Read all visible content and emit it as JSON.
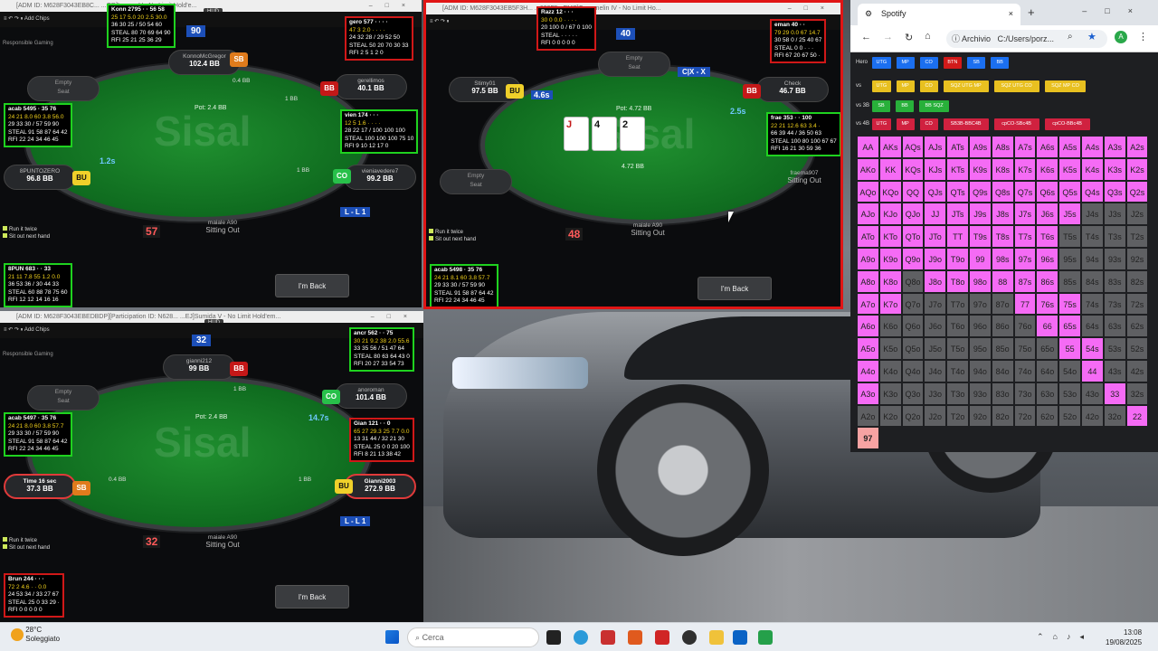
{
  "tables": [
    {
      "title": "[ADM ID: M628F3043EB8C... ...OD]Lumen V - No Limit Hold'e...",
      "hud_tag": "HUD",
      "toolbar_item": "Add Chips",
      "responsible": "Responsible Gaming",
      "pot": "Pot: 2.4 BB",
      "bet_top": "0.4 BB",
      "bet_right": "1 BB",
      "bet_bottom": "1 BB",
      "timer_left": "1.2s",
      "center_number": "57",
      "top_number": "90",
      "lbox": "L - L 1",
      "seats": {
        "top": {
          "name": "KonnoMcGregor",
          "stack": "102.4 BB"
        },
        "right_top": {
          "name": "gerellimos",
          "stack": "40.1 BB"
        },
        "left_top": {
          "name": "Empty",
          "stack": "Seat"
        },
        "left_bottom": {
          "name": "8PUNTOZERO",
          "stack": "96.8 BB"
        },
        "right_bottom": {
          "name": "vieniavedere7",
          "stack": "99.2 BB"
        },
        "bottom": {
          "name": "maiale A90",
          "status": "Sitting Out"
        }
      },
      "huds": {
        "a": [
          "Konn 2795 · · 56 58",
          "25 17 5.0 20 2.5 30.0",
          "36 30 25 / 50 54 60",
          "STEAL 80 70 69 64 90",
          "RFI 25 21 25 36 29"
        ],
        "b": [
          "gero 577 · · · ·",
          "47 3 2.0 · · · ·",
          "24 32 28 / 29 52 50",
          "STEAL 50 20 70 30 33",
          "RFI 2 5 1 2 0"
        ],
        "c": [
          "acab 5495 · 35 76",
          "24 21 8.0 60 3.8 56.0",
          "29 33 30 / 57 59 90",
          "STEAL 91 58 87 64 42",
          "RFI 22 24 34 46 45"
        ],
        "d": [
          "vien 174 · · ·",
          "12 5 1.6 · · · ·",
          "28 22 17 / 100 100 100",
          "STEAL 100 100 100 75 10",
          "RFI 9 10 12 17 0"
        ],
        "e": [
          "8PUN 683 · · 33",
          "21 11 7.8 55 1.2 0.0",
          "36 53 36 / 30 44 33",
          "STEAL 60 88 78 75 60",
          "RFI 12 12 14 16 16"
        ]
      },
      "run_it_twice": "Run it twice",
      "sit_out_next": "Sit out next hand",
      "button": "I'm Back"
    },
    {
      "title": "[ADM ID: M628F3043EB5F3H... ...628F5...EMS]Crommelin IV - No Limit Ho...",
      "pot": "Pot: 4.72 BB",
      "pot_chip": "4.72 BB",
      "cards": [
        "J",
        "4",
        "2"
      ],
      "center_number": "48",
      "top_number": "40",
      "timer_left": "4.6s",
      "timer_right": "2.5s",
      "action": "C|X - X",
      "seats": {
        "top": {
          "name": "Empty",
          "stack": "Seat"
        },
        "left_top": {
          "name": "Stimy01",
          "stack": "97.5 BB"
        },
        "right_top": {
          "name": "Check",
          "stack": "46.7 BB"
        },
        "left_bottom": {
          "name": "Empty",
          "stack": "Seat"
        },
        "right_bottom": {
          "name": "fraema907",
          "status": "Sitting Out"
        },
        "bottom": {
          "name": "maiale A90",
          "status": "Sitting Out"
        }
      },
      "huds": {
        "a": [
          "Razz 12 · · ·",
          "30 0 0.0 · · · ·",
          "20 100 0 / 67 0 100",
          "STEAL · · · · ·",
          "RFI 0 0 0 0 0"
        ],
        "b": [
          "eman 40 · ·",
          "79 29 0.0 67 14.7",
          "30 58 0 / 25 40 67",
          "STEAL 0 0 · · ·",
          "RFI 67 20 67 50 ·"
        ],
        "c": [
          "frae 353 · · 100",
          "22 21 12.6 63 3.4 ·",
          "66 39 44 / 36 50 63",
          "STEAL 100 80 100 67 67",
          "RFI 16 21 30 59 36"
        ],
        "d": [
          "acab 5498 · 35 76",
          "24 21 8.1 60 3.8 57.7",
          "29 33 30 / 57 59 90",
          "STEAL 91 58 87 64 42",
          "RFI 22 24 34 46 45"
        ]
      },
      "run_it_twice": "Run it twice",
      "sit_out_next": "Sit out next hand",
      "button": "I'm Back"
    },
    {
      "title": "[ADM ID: M628F3043EBEDBDP][Participation ID: N628... ...EJ]Sumida V - No Limit Hold'em...",
      "hud_tag": "HUD",
      "toolbar_item": "Add Chips",
      "responsible": "Responsible Gaming",
      "pot": "Pot: 2.4 BB",
      "bet_top": "1 BB",
      "bet_right": "1 BB",
      "bet_left": "0.4 BB",
      "timer_right": "14.7s",
      "center_number": "32",
      "top_number": "32",
      "lbox": "L - L 1",
      "seats": {
        "top": {
          "name": "gianni212",
          "stack": "99 BB"
        },
        "left_top": {
          "name": "Empty",
          "stack": "Seat"
        },
        "right_top": {
          "name": "anoroman",
          "stack": "101.4 BB"
        },
        "left_bottom": {
          "name": "Time 16 sec",
          "stack": "37.3 BB"
        },
        "right_bottom": {
          "name": "Gianni2003",
          "stack": "272.9 BB"
        },
        "bottom": {
          "name": "maiale A90",
          "status": "Sitting Out"
        }
      },
      "huds": {
        "a": [
          "ancr 562 · · 75",
          "30 21 9.2 38 2.0 55.6",
          "33 35 56 / 51 47 64",
          "STEAL 80 63 64 43 0",
          "RFI 20 27 33 54 73"
        ],
        "b": [
          "acab 5497 · 35 76",
          "24 21 8.0 60 3.8 57.7",
          "29 33 30 / 57 59 90",
          "STEAL 91 58 87 64 42",
          "RFI 22 24 34 46 45"
        ],
        "c": [
          "Gian 121 · · 0",
          "65 27 29.3 25 7.7 0.0",
          "13 31 44 / 32 21 30",
          "STEAL 25 0 0 20 100",
          "RFI 8 21 13 38 42"
        ],
        "d": [
          "Brun 244 · · ·",
          "72 2 4.6 · · 0.0",
          "24 53 34 / 33 27 67",
          "STEAL 25 0 33 29 ·",
          "RFI 0 0 0 0 0"
        ]
      },
      "run_it_twice": "Run it twice",
      "sit_out_next": "Sit out next hand",
      "button": "I'm Back"
    }
  ],
  "browser": {
    "tab_title": "Spotify",
    "url_prefix": "Archivio",
    "url": "C:/Users/porz...",
    "rows": {
      "hero_label": "Hero",
      "hero": [
        "UTG",
        "MP",
        "CO",
        "BTN",
        "SB",
        "BB"
      ],
      "vs_label": "vs",
      "vs": [
        "UTG",
        "MP",
        "CO",
        "SQZ UTG MP",
        "SQZ UTG CO",
        "SQZ MP CO"
      ],
      "vs3b_label": "vs 3B",
      "vs3b": [
        "SB",
        "BB",
        "BB SQZ"
      ],
      "vs4b_label": "vs 4B",
      "vs4b": [
        "UTG",
        "MP",
        "CO",
        "SB3B-BBC4B",
        "cpCO-SBc4B",
        "cpCO-BBc4B"
      ]
    },
    "grid": [
      [
        "AA",
        "AKs",
        "AQs",
        "AJs",
        "ATs",
        "A9s",
        "A8s",
        "A7s",
        "A6s",
        "A5s",
        "A4s",
        "A3s",
        "A2s"
      ],
      [
        "AKo",
        "KK",
        "KQs",
        "KJs",
        "KTs",
        "K9s",
        "K8s",
        "K7s",
        "K6s",
        "K5s",
        "K4s",
        "K3s",
        "K2s"
      ],
      [
        "AQo",
        "KQo",
        "QQ",
        "QJs",
        "QTs",
        "Q9s",
        "Q8s",
        "Q7s",
        "Q6s",
        "Q5s",
        "Q4s",
        "Q3s",
        "Q2s"
      ],
      [
        "AJo",
        "KJo",
        "QJo",
        "JJ",
        "JTs",
        "J9s",
        "J8s",
        "J7s",
        "J6s",
        "J5s",
        "J4s",
        "J3s",
        "J2s"
      ],
      [
        "ATo",
        "KTo",
        "QTo",
        "JTo",
        "TT",
        "T9s",
        "T8s",
        "T7s",
        "T6s",
        "T5s",
        "T4s",
        "T3s",
        "T2s"
      ],
      [
        "A9o",
        "K9o",
        "Q9o",
        "J9o",
        "T9o",
        "99",
        "98s",
        "97s",
        "96s",
        "95s",
        "94s",
        "93s",
        "92s"
      ],
      [
        "A8o",
        "K8o",
        "Q8o",
        "J8o",
        "T8o",
        "98o",
        "88",
        "87s",
        "86s",
        "85s",
        "84s",
        "83s",
        "82s"
      ],
      [
        "A7o",
        "K7o",
        "Q7o",
        "J7o",
        "T7o",
        "97o",
        "87o",
        "77",
        "76s",
        "75s",
        "74s",
        "73s",
        "72s"
      ],
      [
        "A6o",
        "K6o",
        "Q6o",
        "J6o",
        "T6o",
        "96o",
        "86o",
        "76o",
        "66",
        "65s",
        "64s",
        "63s",
        "62s"
      ],
      [
        "A5o",
        "K5o",
        "Q5o",
        "J5o",
        "T5o",
        "95o",
        "85o",
        "75o",
        "65o",
        "55",
        "54s",
        "53s",
        "52s"
      ],
      [
        "A4o",
        "K4o",
        "Q4o",
        "J4o",
        "T4o",
        "94o",
        "84o",
        "74o",
        "64o",
        "54o",
        "44",
        "43s",
        "42s"
      ],
      [
        "A3o",
        "K3o",
        "Q3o",
        "J3o",
        "T3o",
        "93o",
        "83o",
        "73o",
        "63o",
        "53o",
        "43o",
        "33",
        "32s"
      ],
      [
        "A2o",
        "K2o",
        "Q2o",
        "J2o",
        "T2o",
        "92o",
        "82o",
        "72o",
        "62o",
        "52o",
        "42o",
        "32o",
        "22"
      ]
    ],
    "counter": "97",
    "colors": {
      "in_range": "#f56bf5",
      "out_range": "#5f6063",
      "pair": "#f56bf5"
    }
  },
  "taskbar": {
    "weather_temp": "28°C",
    "weather_desc": "Soleggiato",
    "search": "Cerca",
    "time": "13:08",
    "date": "19/08/2025"
  }
}
